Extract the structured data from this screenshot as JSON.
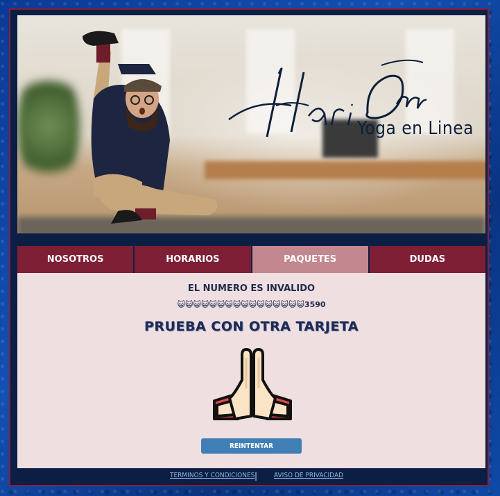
{
  "hero": {
    "title_script": "Hari Om",
    "subtitle": "Yoga en Linea"
  },
  "tabs": [
    {
      "label": "NOSOTROS",
      "active": false
    },
    {
      "label": "HORARIOS",
      "active": false
    },
    {
      "label": "PAQUETES",
      "active": true
    },
    {
      "label": "DUDAS",
      "active": false
    }
  ],
  "panel": {
    "error_title": "EL NUMERO ES INVALIDO",
    "card_number": "😺😺😺😺😺😺😺😺😺😺😺😺😺😺😺😺3590",
    "retry_message": "PRUEBA CON OTRA TARJETA",
    "retry_button": "REINTENTAR"
  },
  "footer": {
    "terms_link": "TERMINOS Y CONDICIONES",
    "separator": "|",
    "privacy_link": "AVISO DE PRIVACIDAD"
  },
  "colors": {
    "tab": "#7e1f35",
    "tab_active": "#c2878f",
    "panel_bg": "#efdfe1",
    "frame_bg": "#0b1f45",
    "button": "#3f7fb5"
  },
  "icons": {
    "hands": "praying-hands-icon"
  }
}
